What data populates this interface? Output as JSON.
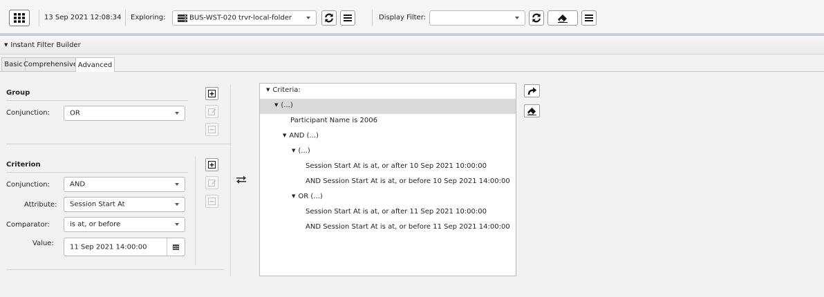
{
  "toolbar": {
    "timestamp": "13 Sep 2021 12:08:34",
    "exploring_label": "Exploring:",
    "exploring_value": "BUS-WST-020 trvr-local-folder",
    "display_filter_label": "Display Filter:",
    "display_filter_value": ""
  },
  "section": {
    "title": "Instant Filter Builder"
  },
  "tabs": [
    {
      "label": "Basic"
    },
    {
      "label": "Comprehensive"
    },
    {
      "label": "Advanced"
    }
  ],
  "group": {
    "heading": "Group",
    "conjunction_label": "Conjunction:",
    "conjunction_value": "OR"
  },
  "criterion": {
    "heading": "Criterion",
    "conjunction_label": "Conjunction:",
    "conjunction_value": "AND",
    "attribute_label": "Attribute:",
    "attribute_value": "Session Start At",
    "comparator_label": "Comparator:",
    "comparator_value": "is at, or before",
    "value_label": "Value:",
    "value_value": "11 Sep 2021 14:00:00"
  },
  "criteria_tree": {
    "root": "Criteria:",
    "rows": [
      {
        "text": "(...)",
        "expand": true
      },
      {
        "text": "Participant Name is 2006",
        "expand": false
      },
      {
        "text": "AND (...)",
        "expand": true
      },
      {
        "text": "(...)",
        "expand": true
      },
      {
        "text": "Session Start At is at, or after 10 Sep 2021 10:00:00",
        "expand": false
      },
      {
        "text": "AND Session Start At is at, or before 10 Sep 2021 14:00:00",
        "expand": false
      },
      {
        "text": "OR (...)",
        "expand": true
      },
      {
        "text": "Session Start At is at, or after 11 Sep 2021 10:00:00",
        "expand": false
      },
      {
        "text": "AND Session Start At is at, or before 11 Sep 2021 14:00:00",
        "expand": false
      }
    ]
  },
  "icons": {
    "apps": "apps-grid-icon",
    "server": "server-icon",
    "refresh": "refresh-icon",
    "menu": "menu-icon",
    "eraser": "eraser-icon",
    "add": "add-icon",
    "edit": "edit-icon",
    "remove": "remove-icon",
    "swap": "swap-icon",
    "redo": "redo-icon",
    "calendar": "calendar-icon"
  },
  "colors": {
    "selected_row": "#d9d9d9",
    "toolbar_bg": "#f5f5f5",
    "accent_bar": "#c9cdd6"
  }
}
